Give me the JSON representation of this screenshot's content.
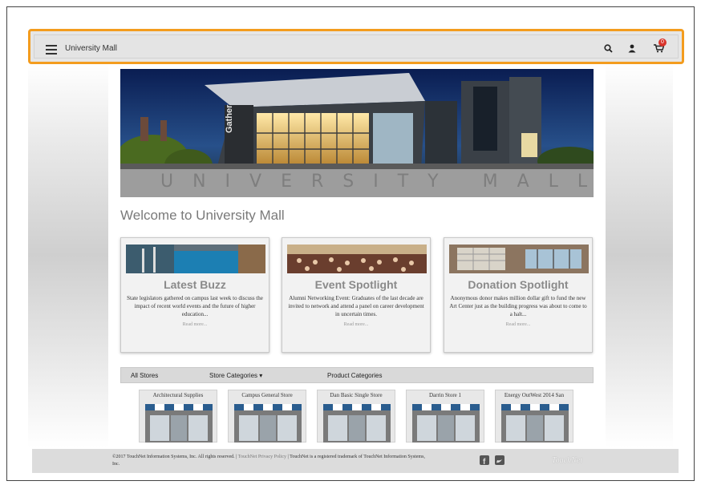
{
  "header": {
    "title": "University Mall",
    "cart_count": "0",
    "icons": [
      "menu-icon",
      "search-icon",
      "user-icon",
      "cart-icon"
    ]
  },
  "banner": {
    "building_sign": "Gather",
    "overlay_text": "UNIVERSITY MALL"
  },
  "welcome": "Welcome to University Mall",
  "cards": [
    {
      "title": "Latest Buzz",
      "text": "State legislators gathered on campus last week to discuss the impact of recent world events and the future of higher education...",
      "more": "Read more..."
    },
    {
      "title": "Event Spotlight",
      "text": "Alumni Networking Event: Graduates of the last decade are invited to network and attend a panel on career development in uncertain times.",
      "more": "Read more..."
    },
    {
      "title": "Donation Spotlight",
      "text": "Anonymous donor makes million dollar gift to fund the new Art Center just as the building progress was about to come to a halt...",
      "more": "Read more..."
    }
  ],
  "store_nav": {
    "all": "All Stores",
    "categories": "Store Categories ▾",
    "products": "Product Categories"
  },
  "stores": [
    "Architectural Supplies",
    "Campus General Store",
    "Dan Basic Single Store",
    "Darrin Store 1",
    "Energy OutWest 2014 San"
  ],
  "footer": {
    "copyright": "©2017 TouchNet Information Systems, Inc. All rights reserved.",
    "privacy": "TouchNet Privacy Policy",
    "trademark": "TouchNet is a registered trademark of TouchNet Information Systems, Inc.",
    "logo": "TouchNet"
  },
  "colors": {
    "highlight": "#f39c1e",
    "badge": "#d9342b"
  }
}
